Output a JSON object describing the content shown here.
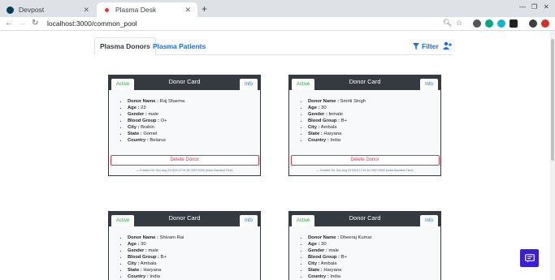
{
  "browser": {
    "tabs": [
      {
        "title": "Devpost",
        "active": false
      },
      {
        "title": "Plasma Desk",
        "active": true
      }
    ],
    "url": "localhost:3000/common_pool"
  },
  "subnav": {
    "tabs": [
      "Plasma Donors",
      "Plasma Patients"
    ],
    "filter_label": "Filter"
  },
  "card_labels": {
    "title": "Donor Card",
    "active": "Active",
    "info": "Info",
    "name": "Donor Name :",
    "age": "Age :",
    "gender": "Gender :",
    "blood_group": "Blood Group :",
    "city": "City :",
    "state": "State :",
    "country": "Country :",
    "delete": "Delete Donor"
  },
  "donors": [
    {
      "name": "Raj Sharma",
      "age": "23",
      "gender": "male",
      "blood_group": "O+",
      "city": "Brahin",
      "state": "Gomel",
      "country": "Belarus",
      "created": "— Created On: Sun Aug 23 2020 07:01:28 GMT+0530 (India Standard Time)"
    },
    {
      "name": "Smriti Singh",
      "age": "30",
      "gender": "female",
      "blood_group": "B+",
      "city": "Ambala",
      "state": "Haryana",
      "country": "India",
      "created": "— Created On: Sun Aug 23 2020 17:41:16 GMT+0530 (India Standard Time)"
    },
    {
      "name": "Shivam Rai",
      "age": "30",
      "gender": "male",
      "blood_group": "B+",
      "city": "Ambala",
      "state": "Haryana",
      "country": "India",
      "created": ""
    },
    {
      "name": "Dheeraj Kumar",
      "age": "30",
      "gender": "male",
      "blood_group": "B+",
      "city": "Ambala",
      "state": "Haryana",
      "country": "India",
      "created": ""
    }
  ]
}
